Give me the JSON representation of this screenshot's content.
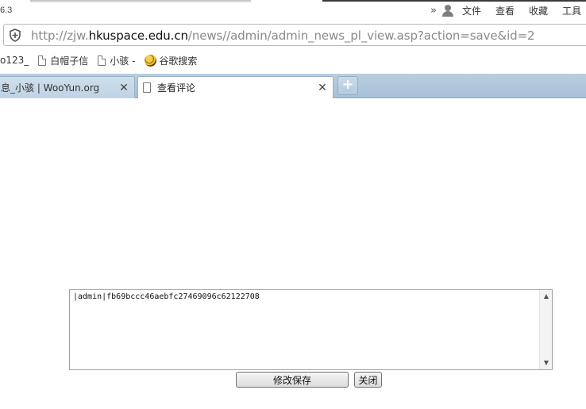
{
  "browser": {
    "version_fragment": "6.3",
    "menu": {
      "more": "»",
      "items": [
        "文件",
        "查看",
        "收藏",
        "工具"
      ]
    },
    "address": {
      "scheme": "http://",
      "subdomain": "zjw.",
      "host": "hkuspace.edu.cn",
      "path": "/news//admin/admin_news_pl_view.asp?action=save&id=2"
    },
    "bookmarks": [
      {
        "label": "o123_",
        "icon": "none"
      },
      {
        "label": "白帽子信",
        "icon": "page-icon"
      },
      {
        "label": "小骇 -",
        "icon": "page-icon"
      },
      {
        "label": "谷歌搜索",
        "icon": "globe-icon"
      }
    ],
    "tabs": [
      {
        "label": "息_小骇 | WooYun.org",
        "active": false
      },
      {
        "label": "查看评论",
        "active": true
      }
    ],
    "new_tab_label": "+",
    "close_glyph": "✕"
  },
  "page": {
    "comment_value": "|admin|fb69bccc46aebfc27469096c62122708",
    "save_button_label": "修改保存",
    "close_button_label": "关闭",
    "scroll_up": "▲",
    "scroll_down": "▼"
  }
}
